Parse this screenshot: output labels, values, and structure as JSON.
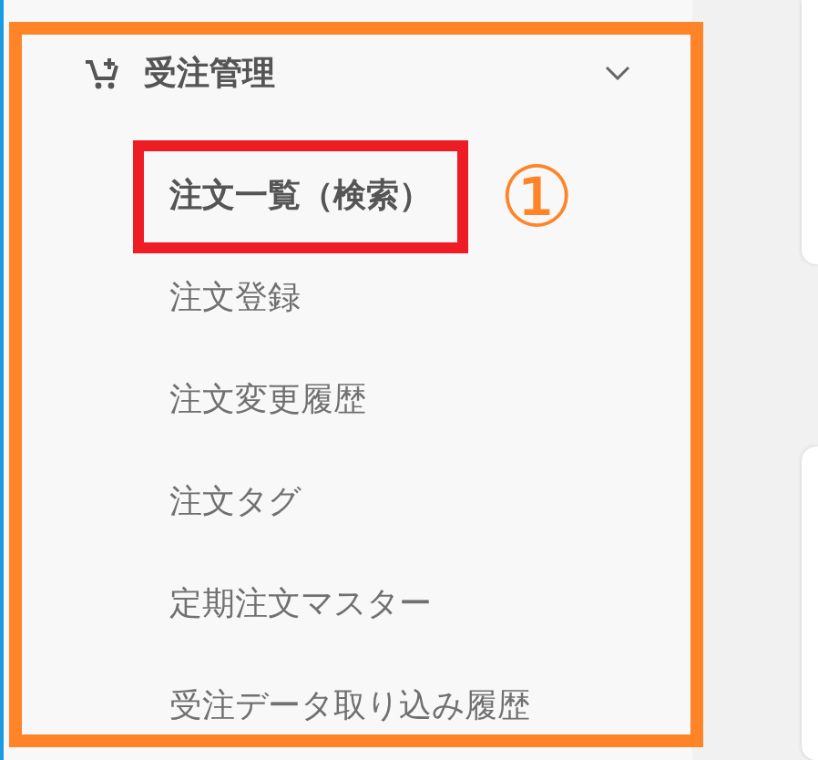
{
  "menu": {
    "title": "受注管理",
    "expanded": true,
    "items": [
      {
        "label": "注文一覧（検索）",
        "selected": true,
        "annotation": "①"
      },
      {
        "label": "注文登録",
        "selected": false
      },
      {
        "label": "注文変更履歴",
        "selected": false
      },
      {
        "label": "注文タグ",
        "selected": false
      },
      {
        "label": "定期注文マスター",
        "selected": false
      },
      {
        "label": "受注データ取り込み履歴",
        "selected": false
      }
    ]
  }
}
